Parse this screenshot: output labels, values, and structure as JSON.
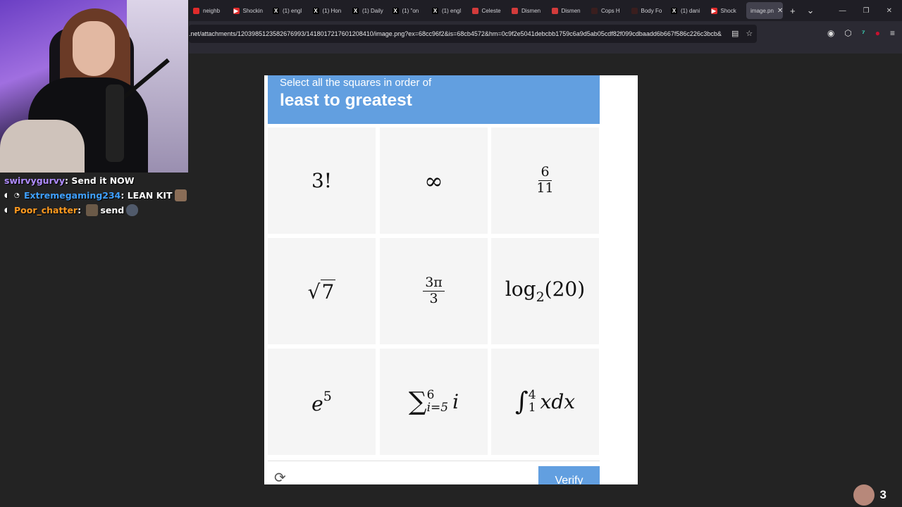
{
  "browser": {
    "tabs": [
      {
        "label": "neighb",
        "fav_color": "#e02b2b",
        "fav": ""
      },
      {
        "label": "Shockin",
        "fav_color": "#e02b2b",
        "fav": "▶"
      },
      {
        "label": "(1) engl",
        "fav_color": "#000000",
        "fav": "X"
      },
      {
        "label": "(1) Hon",
        "fav_color": "#000000",
        "fav": "X"
      },
      {
        "label": "(1) Daily",
        "fav_color": "#000000",
        "fav": "X"
      },
      {
        "label": "(1) \"on",
        "fav_color": "#000000",
        "fav": "X"
      },
      {
        "label": "(1) engl",
        "fav_color": "#000000",
        "fav": "X"
      },
      {
        "label": "Celeste",
        "fav_color": "#d23b3b",
        "fav": ""
      },
      {
        "label": "Dismen",
        "fav_color": "#d23b3b",
        "fav": ""
      },
      {
        "label": "Dismen",
        "fav_color": "#d23b3b",
        "fav": ""
      },
      {
        "label": "Cops H",
        "fav_color": "#3a1e1e",
        "fav": ""
      },
      {
        "label": "Body Fo",
        "fav_color": "#3a1e1e",
        "fav": ""
      },
      {
        "label": "(1) dani",
        "fav_color": "#000000",
        "fav": "X"
      },
      {
        "label": "Shock",
        "fav_color": "#e02b2b",
        "fav": "▶"
      }
    ],
    "active_tab": "image.pn",
    "url": ".net/attachments/1203985123582676993/1418017217601208410/image.png?ex=68cc96f2&is=68cb4572&hm=0c9f2e5041debcbb1759c6a9d5ab05cdf82f099cdbaadd6b667f586c226c3bcb&"
  },
  "chat": [
    {
      "user": "swirvygurvy",
      "user_color": "#b08cff",
      "message": "Send it NOW"
    },
    {
      "user": "Extremegaming234",
      "user_color": "#3fa0ff",
      "message": "LEAN KIT"
    },
    {
      "user": "Poor_chatter",
      "user_color": "#ff9a1f",
      "message": "send"
    }
  ],
  "captcha": {
    "subtitle": "Select all the squares in order of",
    "title": "least to greatest",
    "verify_label": "Verify",
    "accent": "#629fe0",
    "tiles": {
      "t1": "3!",
      "t2": "∞",
      "t3_num": "6",
      "t3_den": "11",
      "t4": "7",
      "t5_num": "3π",
      "t5_den": "3",
      "t6_fn": "log",
      "t6_base": "2",
      "t6_arg": "(20)",
      "t7_base": "e",
      "t7_exp": "5",
      "t8_op": "∑",
      "t8_upper": "6",
      "t8_lower": "i=5",
      "t8_body": "i",
      "t9_op": "∫",
      "t9_upper": "4",
      "t9_lower": "1",
      "t9_body": "xdx"
    }
  },
  "viewer_count": "3"
}
